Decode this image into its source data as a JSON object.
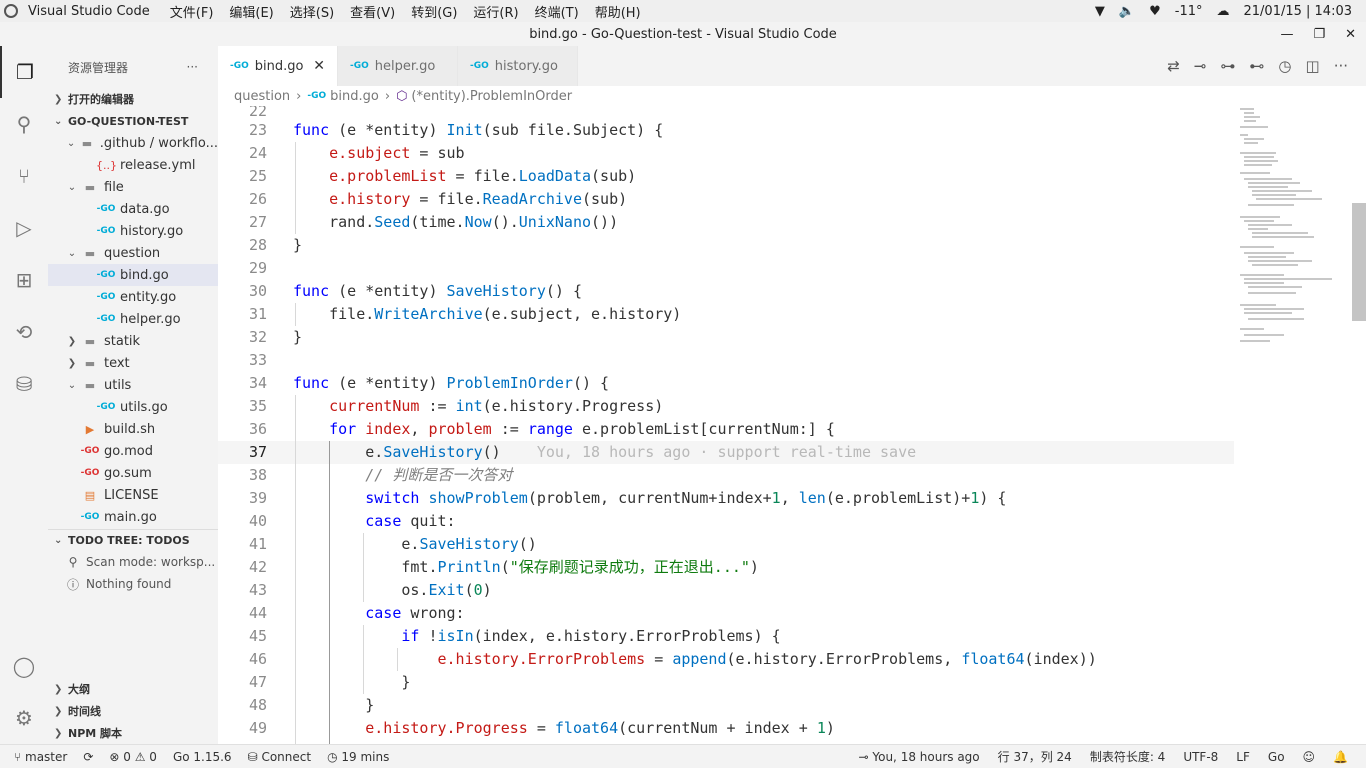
{
  "system": {
    "app_name": "Visual Studio Code",
    "menus": [
      "文件(F)",
      "编辑(E)",
      "选择(S)",
      "查看(V)",
      "转到(G)",
      "运行(R)",
      "终端(T)",
      "帮助(H)"
    ],
    "temperature": "-11°",
    "datetime": "21/01/15 | 14:03"
  },
  "window": {
    "title": "bind.go - Go-Question-test - Visual Studio Code"
  },
  "activity_bar": [
    "explorer-icon",
    "search-icon",
    "source-control-icon",
    "run-debug-icon",
    "extensions-icon",
    "remote-icon",
    "database-icon",
    "account-icon",
    "settings-icon"
  ],
  "sidebar": {
    "header": "资源管理器",
    "more": "···",
    "open_editors": "打开的编辑器",
    "workspace": "GO-QUESTION-TEST",
    "tree": [
      {
        "label": ".github / workflo...",
        "indent": 1,
        "type": "folder",
        "open": true
      },
      {
        "label": "release.yml",
        "indent": 2,
        "type": "yml"
      },
      {
        "label": "file",
        "indent": 1,
        "type": "folder",
        "open": true
      },
      {
        "label": "data.go",
        "indent": 2,
        "type": "go"
      },
      {
        "label": "history.go",
        "indent": 2,
        "type": "go"
      },
      {
        "label": "question",
        "indent": 1,
        "type": "folder",
        "open": true
      },
      {
        "label": "bind.go",
        "indent": 2,
        "type": "go",
        "selected": true
      },
      {
        "label": "entity.go",
        "indent": 2,
        "type": "go"
      },
      {
        "label": "helper.go",
        "indent": 2,
        "type": "go"
      },
      {
        "label": "statik",
        "indent": 1,
        "type": "folder",
        "open": false
      },
      {
        "label": "text",
        "indent": 1,
        "type": "folder",
        "open": false
      },
      {
        "label": "utils",
        "indent": 1,
        "type": "folder",
        "open": true
      },
      {
        "label": "utils.go",
        "indent": 2,
        "type": "go"
      },
      {
        "label": "build.sh",
        "indent": 1,
        "type": "sh"
      },
      {
        "label": "go.mod",
        "indent": 1,
        "type": "mod"
      },
      {
        "label": "go.sum",
        "indent": 1,
        "type": "mod"
      },
      {
        "label": "LICENSE",
        "indent": 1,
        "type": "lic"
      },
      {
        "label": "main.go",
        "indent": 1,
        "type": "go"
      }
    ],
    "todo_title": "TODO TREE: TODOS",
    "todo_items": [
      "Scan mode: worksp...",
      "Nothing found"
    ],
    "bottom_sections": [
      "大纲",
      "时间线",
      "NPM 脚本"
    ]
  },
  "tabs": [
    {
      "label": "bind.go",
      "active": true
    },
    {
      "label": "helper.go",
      "active": false
    },
    {
      "label": "history.go",
      "active": false
    }
  ],
  "breadcrumbs": [
    "question",
    "bind.go",
    "(*entity).ProblemInOrder"
  ],
  "editor": {
    "line_numbers": [
      "22",
      "23",
      "24",
      "25",
      "26",
      "27",
      "28",
      "29",
      "30",
      "31",
      "32",
      "33",
      "34",
      "35",
      "36",
      "37",
      "38",
      "39",
      "40",
      "41",
      "42",
      "43",
      "44",
      "45",
      "46",
      "47",
      "48",
      "49"
    ],
    "current_line": "37",
    "blame": "You, 18 hours ago · support real-time save"
  },
  "status_bar": {
    "branch": "master",
    "problems": "⊗ 0 ⚠ 0",
    "go_version": "Go 1.15.6",
    "connect": "Connect",
    "timer": "19 mins",
    "author": "You, 18 hours ago",
    "position": "行 37，列 24",
    "tab_size": "制表符长度: 4",
    "encoding": "UTF-8",
    "eol": "LF",
    "language": "Go"
  }
}
